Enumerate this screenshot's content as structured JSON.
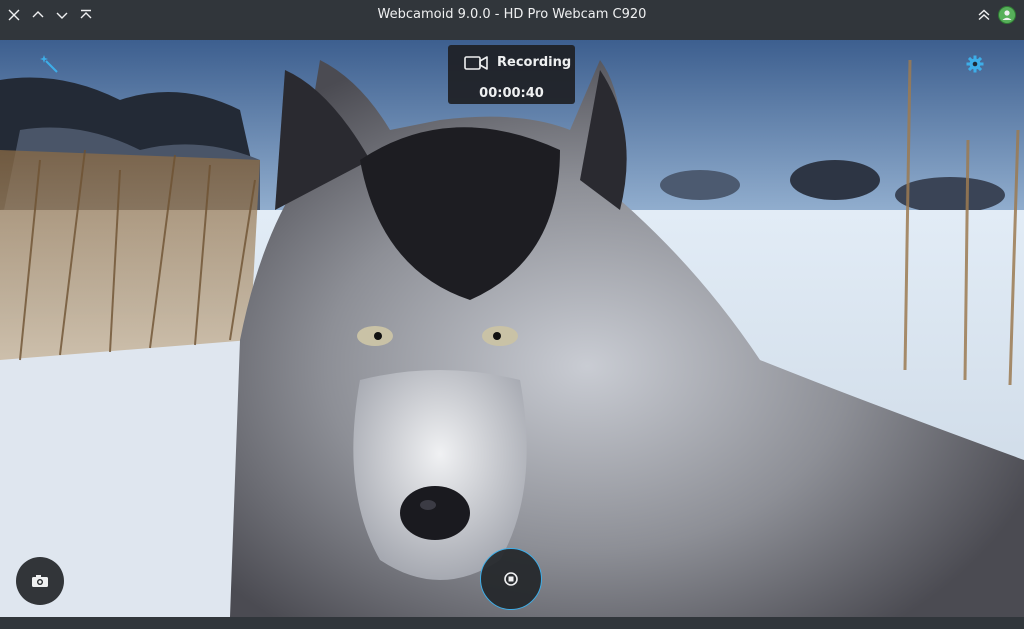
{
  "window": {
    "title": "Webcamoid 9.0.0 - HD Pro Webcam C920"
  },
  "titlebar": {
    "buttons": [
      "close-icon",
      "minimize-icon",
      "maximize-icon",
      "keep-above-icon"
    ],
    "right_buttons": [
      "shade-icon",
      "app-icon"
    ]
  },
  "recording": {
    "label": "Recording",
    "elapsed": "00:00:40"
  },
  "controls": {
    "effects_icon": "magic-wand-icon",
    "settings_icon": "gear-icon",
    "photo_icon": "camera-photo-icon",
    "stop_icon": "stop-record-icon"
  },
  "colors": {
    "titlebar_bg": "#31363b",
    "accent": "#3daee9",
    "overlay_bg": "#1e2024"
  }
}
